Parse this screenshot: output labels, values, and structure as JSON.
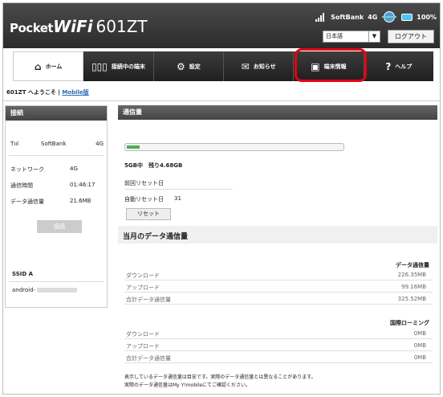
{
  "header": {
    "logo_pocket": "Pocket",
    "logo_wifi": "WiFi",
    "logo_model": "601ZT",
    "carrier": "SoftBank",
    "network": "4G",
    "battery_percent": "100%",
    "language": "日本語",
    "logout": "ログアウト"
  },
  "nav": {
    "items": [
      {
        "label": "ホーム",
        "icon": "home-icon"
      },
      {
        "label": "接続中の端末",
        "icon": "devices-icon"
      },
      {
        "label": "設定",
        "icon": "gear-icon"
      },
      {
        "label": "お知らせ",
        "icon": "mail-icon"
      },
      {
        "label": "端末情報",
        "icon": "device-info-icon"
      },
      {
        "label": "ヘルプ",
        "icon": "help-icon"
      }
    ],
    "active": "ホーム"
  },
  "welcome": {
    "text": "601ZT へようこそ |",
    "link": "Mobile版"
  },
  "connection": {
    "title": "接続",
    "carrier": "SoftBank",
    "carrier_network": "4G",
    "rows": [
      {
        "label": "ネットワーク",
        "value": "4G"
      },
      {
        "label": "通信時間",
        "value": "01:46:17"
      },
      {
        "label": "データ通信量",
        "value": "21.6MB"
      }
    ],
    "connect_button": "接続",
    "ssid_label": "SSID A",
    "ssid_value": "android-"
  },
  "usage": {
    "title": "通信量",
    "progress_fraction": 0.06,
    "summary": "5GB中　残り4.68GB",
    "last_reset_label": "前回リセット日",
    "auto_reset_label": "自動リセット日",
    "auto_reset_value": "31",
    "reset_button": "リセット"
  },
  "monthly": {
    "title": "当月のデータ通信量",
    "domestic_header": "データ通信量",
    "domestic": [
      {
        "label": "ダウンロード",
        "value": "226.35MB"
      },
      {
        "label": "アップロード",
        "value": "99.16MB"
      },
      {
        "label": "合計データ通信量",
        "value": "325.52MB"
      }
    ],
    "roaming_header": "国際ローミング",
    "roaming": [
      {
        "label": "ダウンロード",
        "value": "0MB"
      },
      {
        "label": "アップロード",
        "value": "0MB"
      },
      {
        "label": "合計データ通信量",
        "value": "0MB"
      }
    ],
    "note1": "表示しているデータ通信量は目安です。実際のデータ通信量とは異なることがあります。",
    "note2": "実際のデータ通信量はMy Y!mobileにてご確認ください。"
  },
  "colors": {
    "highlight": "#e60012",
    "progress": "#4caf50",
    "link": "#2a6bb5"
  }
}
